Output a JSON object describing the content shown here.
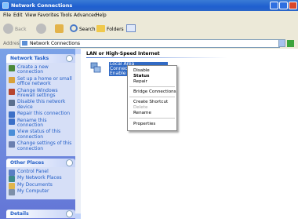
{
  "window": {
    "title": "Network Connections"
  },
  "menu": [
    "File",
    "Edit",
    "View",
    "Favorites",
    "Tools",
    "Advanced",
    "Help"
  ],
  "toolbar": {
    "back": "Back",
    "search": "Search",
    "folders": "Folders"
  },
  "address": {
    "label": "Address",
    "value": "Network Connections",
    "go": "Go"
  },
  "network_tasks": {
    "title": "Network Tasks",
    "items": [
      "Create a new connection",
      "Set up a home or small office network",
      "Change Windows Firewall settings",
      "Disable this network device",
      "Repair this connection",
      "Rename this connection",
      "View status of this connection",
      "Change settings of this connection"
    ]
  },
  "other_places": {
    "title": "Other Places",
    "items": [
      "Control Panel",
      "My Network Places",
      "My Documents",
      "My Computer"
    ]
  },
  "details": {
    "title": "Details"
  },
  "content": {
    "group_title": "LAN or High-Speed Internet",
    "connection_lines": [
      "Local Area",
      "Connec",
      "Enable"
    ]
  },
  "context_menu": {
    "items": [
      "Disable",
      "Status",
      "Repair",
      "Bridge Connections",
      "Create Shortcut",
      "Delete",
      "Rename",
      "Properties"
    ]
  }
}
